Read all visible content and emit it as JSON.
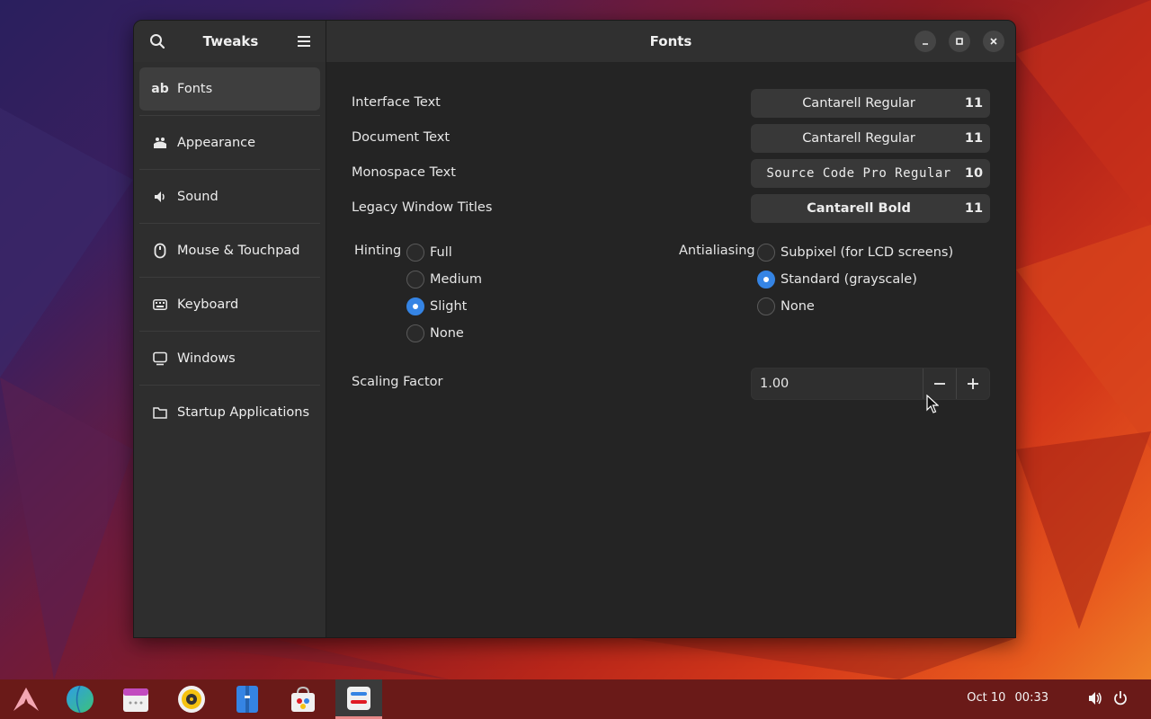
{
  "colors": {
    "accent": "#3584e4",
    "window_bg": "#242424",
    "sidebar_bg": "#2e2e2e",
    "taskbar_bg": "#6a1a18"
  },
  "sidebar": {
    "title": "Tweaks",
    "search_icon": "search-icon",
    "menu_icon": "hamburger-menu-icon",
    "items": [
      {
        "label": "Fonts",
        "icon": "font-ab-icon",
        "active": true
      },
      {
        "label": "Appearance",
        "icon": "appearance-icon"
      },
      {
        "label": "Sound",
        "icon": "speaker-icon"
      },
      {
        "label": "Mouse & Touchpad",
        "icon": "mouse-icon"
      },
      {
        "label": "Keyboard",
        "icon": "keyboard-icon"
      },
      {
        "label": "Windows",
        "icon": "monitor-icon"
      },
      {
        "label": "Startup Applications",
        "icon": "folder-icon"
      }
    ]
  },
  "main": {
    "title": "Fonts",
    "fonts": [
      {
        "label": "Interface Text",
        "font": "Cantarell Regular",
        "size": "11"
      },
      {
        "label": "Document Text",
        "font": "Cantarell Regular",
        "size": "11"
      },
      {
        "label": "Monospace Text",
        "font": "Source Code Pro Regular",
        "size": "10"
      },
      {
        "label": "Legacy Window Titles",
        "font": "Cantarell Bold",
        "size": "11"
      }
    ],
    "hinting": {
      "label": "Hinting",
      "options": [
        "Full",
        "Medium",
        "Slight",
        "None"
      ],
      "selected": "Slight"
    },
    "antialiasing": {
      "label": "Antialiasing",
      "options": [
        "Subpixel (for LCD screens)",
        "Standard (grayscale)",
        "None"
      ],
      "selected": "Standard (grayscale)"
    },
    "scaling": {
      "label": "Scaling Factor",
      "value": "1.00"
    }
  },
  "taskbar": {
    "apps": [
      "arch-logo-icon",
      "browser-globe-icon",
      "calendar-icon",
      "music-player-icon",
      "file-manager-icon",
      "software-store-icon",
      "tweaks-icon"
    ],
    "active_app": "tweaks-icon",
    "date": "Oct 10",
    "time": "00:33",
    "tray": [
      "volume-icon",
      "power-icon"
    ]
  }
}
